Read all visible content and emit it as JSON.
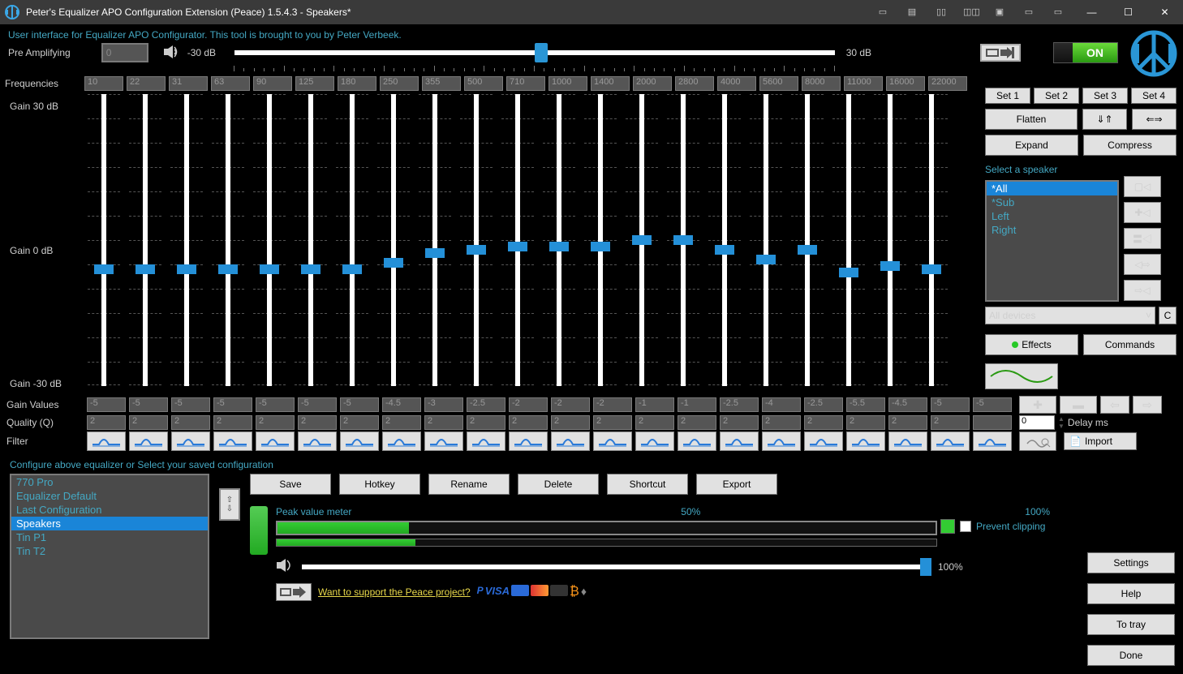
{
  "title": "Peter's Equalizer APO Configuration Extension (Peace) 1.5.4.3 - Speakers*",
  "subtitle": "User interface for Equalizer APO Configurator. This tool is brought to you by Peter Verbeek.",
  "preamp": {
    "label": "Pre Amplifying",
    "value": "0",
    "min": "-30 dB",
    "max": "30 dB",
    "pos": 50
  },
  "onswitch": "ON",
  "freq_label": "Frequencies",
  "gain30": "Gain 30 dB",
  "gain0": "Gain 0 dB",
  "gainm30": "Gain -30 dB",
  "bands": {
    "freqs": [
      "10",
      "22",
      "31",
      "63",
      "90",
      "125",
      "180",
      "250",
      "355",
      "500",
      "710",
      "1000",
      "1400",
      "2000",
      "2800",
      "4000",
      "5600",
      "8000",
      "11000",
      "16000",
      "22000"
    ],
    "gains": [
      "-5",
      "-5",
      "-5",
      "-5",
      "-5",
      "-5",
      "-5",
      "-4.5",
      "-3",
      "-2.5",
      "-2",
      "-2",
      "-2",
      "-1",
      "-1",
      "-2.5",
      "-4",
      "-2.5",
      "-5.5",
      "-4.5",
      "-5",
      "-5"
    ],
    "quality": [
      "2",
      "2",
      "2",
      "2",
      "2",
      "2",
      "2",
      "2",
      "2",
      "2",
      "2",
      "2",
      "2",
      "2",
      "2",
      "2",
      "2",
      "2",
      "2",
      "2",
      "2"
    ],
    "thumb_pos": [
      228,
      228,
      228,
      228,
      228,
      228,
      228,
      220,
      208,
      204,
      200,
      200,
      200,
      192,
      192,
      204,
      216,
      204,
      232,
      224,
      228,
      228
    ]
  },
  "gain_values_label": "Gain Values",
  "quality_label": "Quality (Q)",
  "filter_label": "Filter",
  "sets": [
    "Set 1",
    "Set 2",
    "Set 3",
    "Set 4"
  ],
  "flatten": "Flatten",
  "expand": "Expand",
  "compress": "Compress",
  "select_speaker": "Select a speaker",
  "speakers": [
    "*All",
    "*Sub",
    "Left",
    "Right"
  ],
  "speaker_sel": 0,
  "device": "All devices",
  "device_c": "C",
  "effects": "Effects",
  "commands": "Commands",
  "delay_val": "0",
  "delay_label": "Delay ms",
  "import": "Import",
  "config_label": "Configure above equalizer or Select your saved configuration",
  "configs": [
    "770 Pro",
    "Equalizer Default",
    "Last Configuration",
    "Speakers",
    "Tin P1",
    "Tin T2"
  ],
  "config_sel": 3,
  "actions": [
    "Save",
    "Hotkey",
    "Rename",
    "Delete",
    "Shortcut",
    "Export"
  ],
  "meter": {
    "label": "Peak value meter",
    "mid": "50%",
    "full": "100%",
    "fill1": 20,
    "fill2": 21
  },
  "prevent": "Prevent clipping",
  "volume": "100%",
  "support": "Want to support the Peace project?",
  "right_btns": [
    "Settings",
    "Help",
    "To tray",
    "Done"
  ]
}
